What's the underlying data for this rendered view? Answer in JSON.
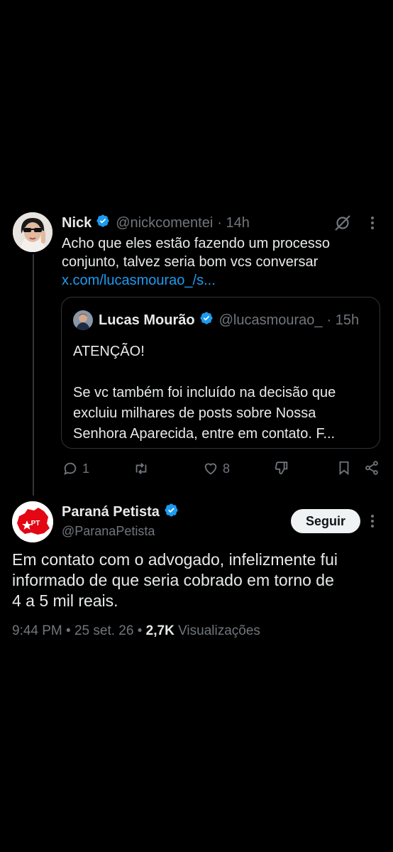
{
  "reply": {
    "name": "Nick",
    "handle": "@nickcomentei",
    "time": "· 14h",
    "text_line1": "Acho que eles estão fazendo um processo",
    "text_line2": "conjunto, talvez seria bom vcs conversar",
    "link": "x.com/lucasmourao_/s...",
    "quote": {
      "name": "Lucas Mourão",
      "handle": "@lucasmourao_",
      "time": "· 15h",
      "line1": "ATENÇÃO!",
      "line2": "Se vc também foi incluído na decisão que",
      "line3": "excluiu milhares de posts sobre Nossa",
      "line4": "Senhora Aparecida, entre em contato. F..."
    },
    "actions": {
      "replies": "1",
      "retweets": "",
      "likes": "8"
    }
  },
  "main_post": {
    "name": "Paraná Petista",
    "handle": "@ParanaPetista",
    "follow_label": "Seguir",
    "text_line1": "Em contato com o advogado, infelizmente fui",
    "text_line2": "informado de que seria cobrado em torno de",
    "text_line3": "4 a 5 mil reais.",
    "meta": {
      "time": "9:44 PM",
      "sep1": " • ",
      "date": "25 set. 26",
      "sep2": " • ",
      "views_count": "2,7K",
      "views_label": " Visualizações"
    },
    "avatar_logo_text": "PT"
  },
  "colors": {
    "background": "#000000",
    "text": "#e7e9ea",
    "muted": "#71767b",
    "link": "#1d9bf0",
    "verified": "#1d9bf0",
    "pt_red": "#e30613"
  }
}
